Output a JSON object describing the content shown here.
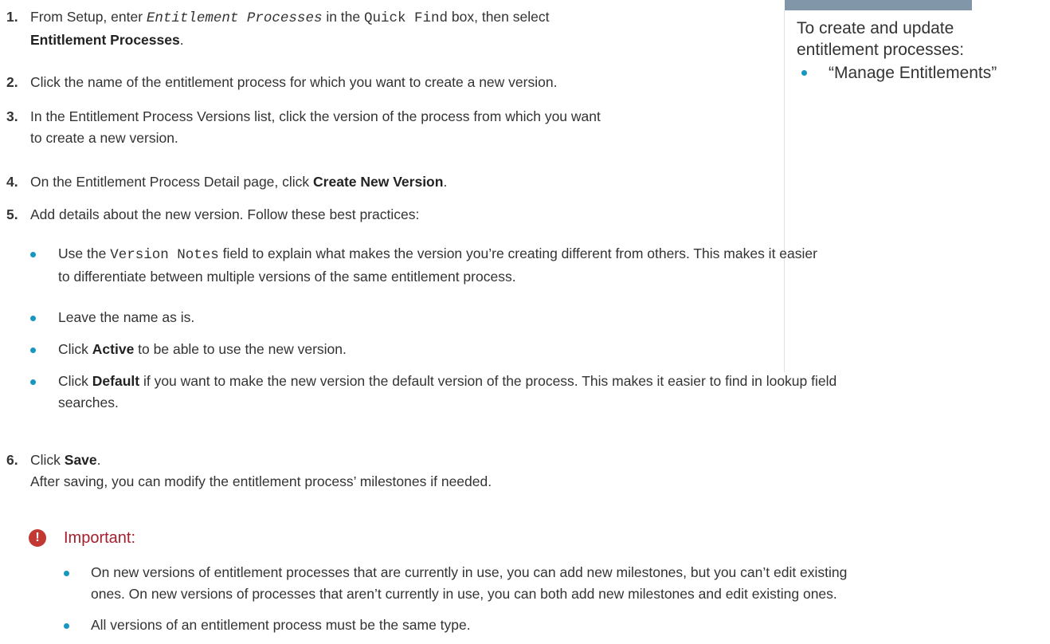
{
  "sidebar": {
    "description": "To create and update entitlement processes:",
    "permission": "“Manage Entitlements”"
  },
  "steps": {
    "s1": {
      "num": "1.",
      "a": "From Setup, enter ",
      "b": "Entitlement Processes",
      "c": " in the ",
      "d": "Quick Find",
      "e": " box, then select",
      "f": "Entitlement Processes",
      "g": "."
    },
    "s2": {
      "num": "2.",
      "text": "Click the name of the entitlement process for which you want to create a new version."
    },
    "s3": {
      "num": "3.",
      "line1": "In the Entitlement Process Versions list, click the version of the process from which you want",
      "line2": "to create a new version."
    },
    "s4": {
      "num": "4.",
      "a": "On the Entitlement Process Detail page, click ",
      "b": "Create New Version",
      "c": "."
    },
    "s5": {
      "num": "5.",
      "text": "Add details about the new version. Follow these best practices:",
      "bullets": {
        "b1": {
          "a": "Use the ",
          "b": "Version Notes",
          "c": " field to explain what makes the version you’re creating different from others. This makes it easier",
          "line2": "to differentiate between multiple versions of the same entitlement process."
        },
        "b2": {
          "text": "Leave the name as is."
        },
        "b3": {
          "a": "Click ",
          "b": "Active",
          "c": " to be able to use the new version."
        },
        "b4": {
          "a": "Click ",
          "b": "Default",
          "c": " if you want to make the new version the default version of the process. This makes it easier to find in lookup field",
          "line2": "searches."
        }
      }
    },
    "s6": {
      "num": "6.",
      "a": "Click ",
      "b": "Save",
      "c": ".",
      "after": "After saving, you can modify the entitlement process’ milestones if needed."
    }
  },
  "important": {
    "icon": "!",
    "label": "Important:",
    "b1_line1": "On new versions of entitlement processes that are currently in use, you can add new milestones, but you can’t edit existing",
    "b1_line2": "ones. On new versions of processes that aren’t currently in use, you can both add new milestones and edit existing ones.",
    "b2": "All versions of an entitlement process must be the same type."
  },
  "colors": {
    "bullet": "#1797c0",
    "sidebar_bar": "#8196a9",
    "important_icon": "#c23934",
    "important_label": "#a61d2d"
  }
}
